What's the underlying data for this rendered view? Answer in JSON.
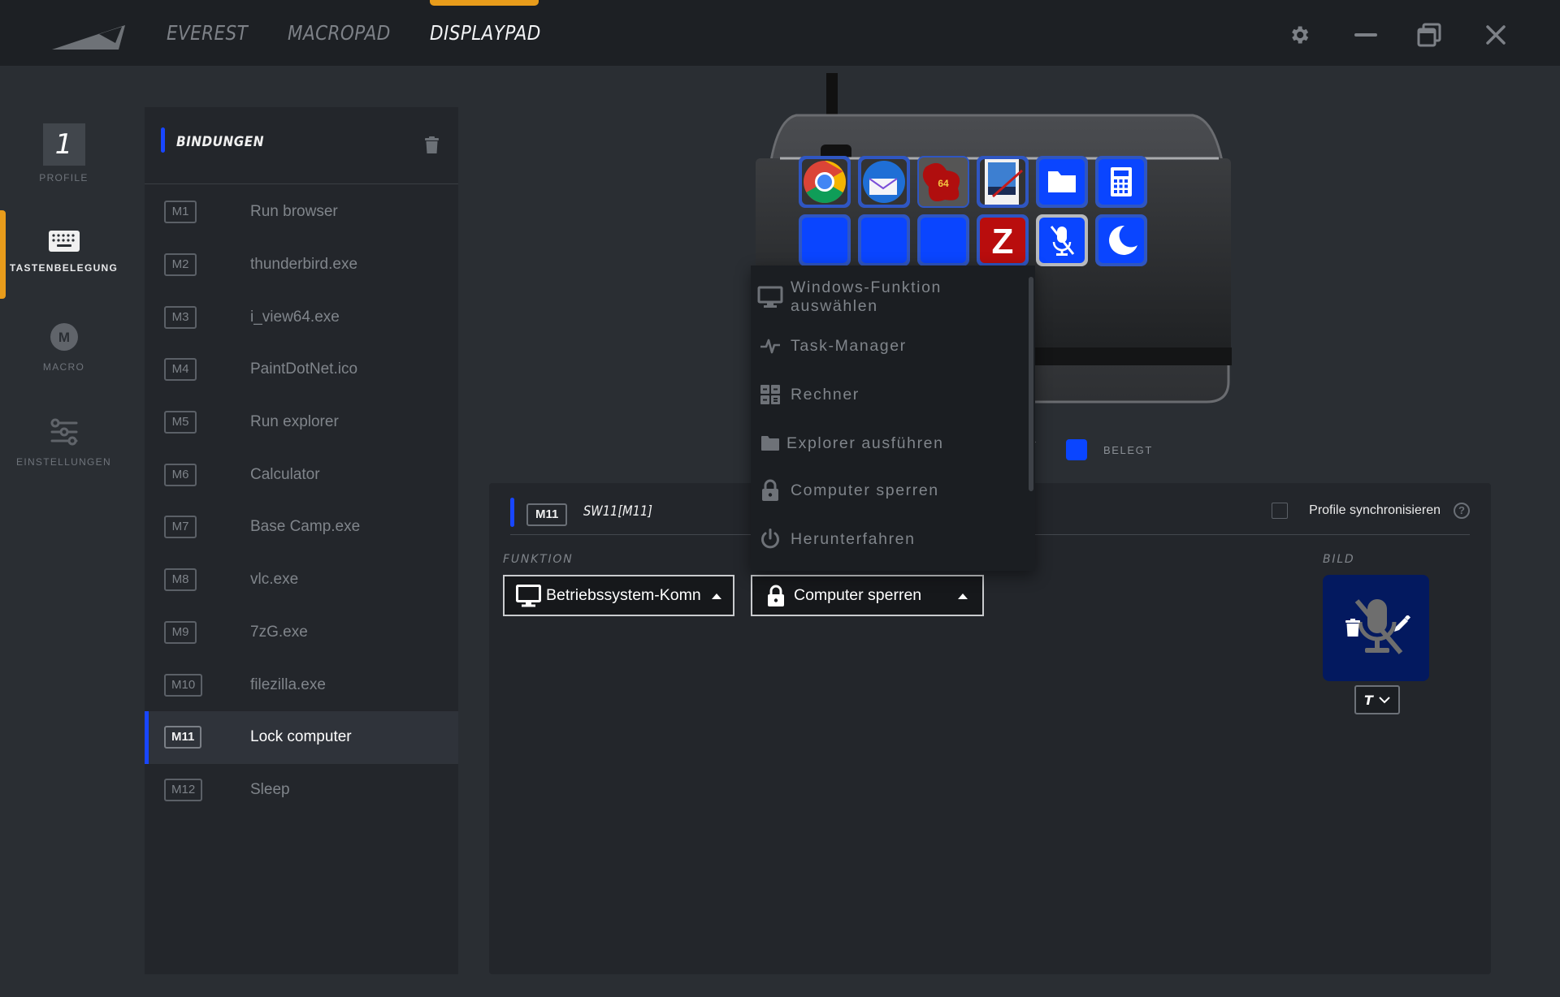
{
  "header": {
    "tabs": [
      {
        "label": "EVEREST",
        "active": false
      },
      {
        "label": "MACROPAD",
        "active": false
      },
      {
        "label": "DISPLAYPAD",
        "active": true
      }
    ],
    "accent_color": "#e89c1b"
  },
  "sidebar": {
    "profile_number": "1",
    "items": [
      {
        "label": "PROFILE",
        "icon": "profile-number",
        "active": false
      },
      {
        "label": "TASTENBELEGUNG",
        "icon": "keyboard-icon",
        "active": true
      },
      {
        "label": "MACRO",
        "icon": "macro-m-icon",
        "active": false
      },
      {
        "label": "EINSTELLUNGEN",
        "icon": "sliders-icon",
        "active": false
      }
    ]
  },
  "bindings": {
    "title": "BINDUNGEN",
    "items": [
      {
        "key": "M1",
        "name": "Run browser"
      },
      {
        "key": "M2",
        "name": "thunderbird.exe"
      },
      {
        "key": "M3",
        "name": "i_view64.exe"
      },
      {
        "key": "M4",
        "name": "PaintDotNet.ico"
      },
      {
        "key": "M5",
        "name": "Run explorer"
      },
      {
        "key": "M6",
        "name": "Calculator"
      },
      {
        "key": "M7",
        "name": "Base Camp.exe"
      },
      {
        "key": "M8",
        "name": "vlc.exe"
      },
      {
        "key": "M9",
        "name": "7zG.exe"
      },
      {
        "key": "M10",
        "name": "filezilla.exe"
      },
      {
        "key": "M11",
        "name": "Lock computer",
        "selected": true
      },
      {
        "key": "M12",
        "name": "Sleep"
      }
    ]
  },
  "device": {
    "keys_row1": [
      "chrome",
      "thunderbird",
      "irfanview",
      "paintdotnet",
      "folder",
      "calculator"
    ],
    "keys_row2": [
      "hidden",
      "hidden",
      "hidden",
      "filezilla",
      "mic-off",
      "moon"
    ],
    "selected_key": "M11"
  },
  "legend": {
    "hidden_label_tail": "T",
    "assigned_label": "BELEGT",
    "assigned_color": "#0a45ff"
  },
  "detail": {
    "key": "M11",
    "key_name": "SW11[M11]",
    "sync_label": "Profile synchronisieren",
    "sync_checked": false,
    "help": "?",
    "function_label": "FUNKTION",
    "function_category": "Betriebssystem-Komn",
    "function_value": "Computer sperren",
    "image_label": "BILD",
    "text_button": "T"
  },
  "menu": {
    "items": [
      {
        "icon": "monitor-icon",
        "label": "Windows-Funktion auswählen"
      },
      {
        "icon": "pulse-icon",
        "label": "Task-Manager"
      },
      {
        "icon": "calculator-grid-icon",
        "label": "Rechner"
      },
      {
        "icon": "folder-icon",
        "label": "Explorer ausführen"
      },
      {
        "icon": "lock-icon",
        "label": "Computer sperren"
      },
      {
        "icon": "power-icon",
        "label": "Herunterfahren"
      }
    ]
  }
}
